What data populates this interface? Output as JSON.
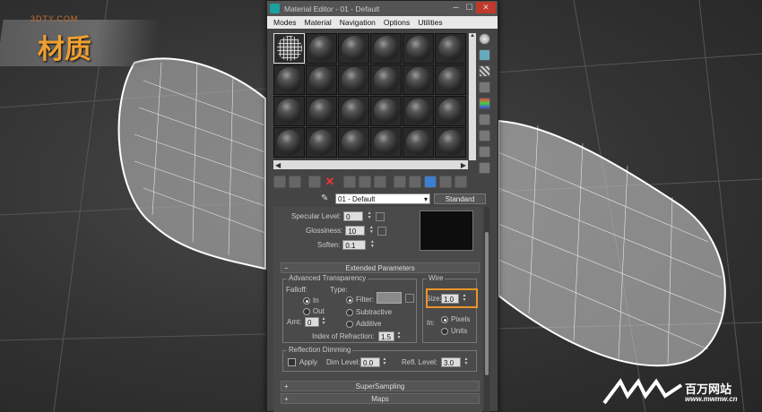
{
  "banner": {
    "title": "材质",
    "site": "3DTY.COM"
  },
  "watermark": {
    "brand": "百万网站",
    "url": "www.mwmw.cn"
  },
  "window": {
    "title": "Material Editor - 01 - Default",
    "menus": [
      "Modes",
      "Material",
      "Navigation",
      "Options",
      "Utilities"
    ]
  },
  "material_name": "01 - Default",
  "material_type": "Standard",
  "basic": {
    "specular_level_label": "Specular Level:",
    "specular_level": "0",
    "glossiness_label": "Glossiness:",
    "glossiness": "10",
    "soften_label": "Soften:",
    "soften": "0.1"
  },
  "extended": {
    "header": "Extended Parameters",
    "adv_transparency": "Advanced Transparency",
    "falloff_label": "Falloff:",
    "type_label": "Type:",
    "falloff_in": "In",
    "falloff_out": "Out",
    "type_filter": "Filter:",
    "type_subtractive": "Subtractive",
    "type_additive": "Additive",
    "amt_label": "Amt:",
    "amt": "0",
    "ior_label": "Index of Refraction:",
    "ior": "1.5",
    "wire_title": "Wire",
    "size_label": "Size:",
    "size": "1.0",
    "in_label": "In:",
    "pixels": "Pixels",
    "units": "Units",
    "reflection_dimming": "Reflection Dimming",
    "apply": "Apply",
    "dim_level_label": "Dim Level:",
    "dim_level": "0.0",
    "refl_level_label": "Refl. Level:",
    "refl_level": "3.0"
  },
  "rollouts": {
    "supersampling": "SuperSampling",
    "maps": "Maps"
  },
  "colors": {
    "highlight": "#e8952a",
    "banner_text": "#f0a030"
  }
}
